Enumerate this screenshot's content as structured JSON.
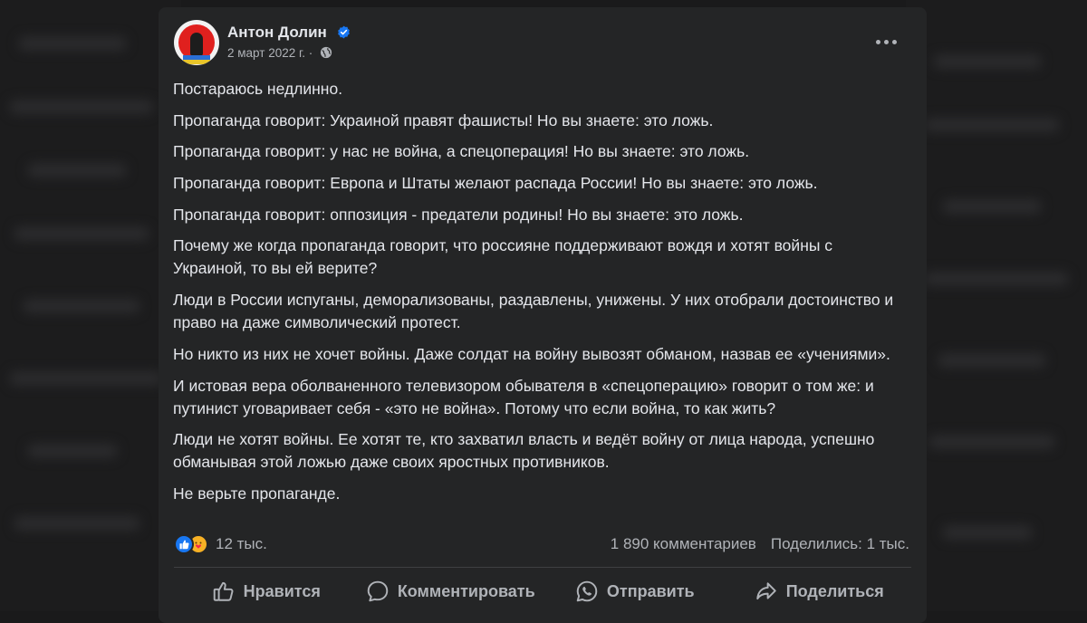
{
  "post": {
    "author": "Антон Долин",
    "date": "2 март 2022 г.",
    "separator": "·",
    "paragraphs": [
      "Постараюсь недлинно.",
      "Пропаганда говорит: Украиной правят фашисты! Но вы знаете: это ложь.",
      "Пропаганда говорит: у нас не война, а спецоперация! Но вы знаете: это ложь.",
      "Пропаганда говорит: Европа и Штаты желают распада России! Но вы знаете: это ложь.",
      "Пропаганда говорит: оппозиция - предатели родины! Но вы знаете: это ложь.",
      "Почему же когда пропаганда говорит, что россияне поддерживают вождя и хотят войны с Украиной, то вы ей верите?",
      "Люди в России испуганы, деморализованы, раздавлены, унижены. У них отобрали достоинство и право на даже символический протест.",
      "Но никто из них не хочет войны. Даже солдат на войну вывозят обманом, назвав ее «учениями».",
      "И истовая вера оболваненного телевизором обывателя в «спецоперацию» говорит о том же: и путинист уговаривает себя - «это не война». Потому что если война, то как жить?",
      "Люди не хотят войны. Ее хотят те, кто захватил власть и ведёт войну от лица народа, успешно обманывая этой ложью даже своих яростных противников.",
      "Не верьте пропаганде."
    ]
  },
  "stats": {
    "reactions_count": "12 тыс.",
    "comments": "1 890 комментариев",
    "shares": "Поделились: 1 тыс."
  },
  "actions": {
    "like": "Нравится",
    "comment": "Комментировать",
    "send": "Отправить",
    "share": "Поделиться"
  },
  "icons": {
    "verified": "verified-badge-icon",
    "audience": "globe-icon",
    "more": "more-options-icon",
    "like": "thumbs-up-icon",
    "comment": "comment-bubble-icon",
    "send": "whatsapp-icon",
    "share": "share-arrow-icon"
  },
  "colors": {
    "card_bg": "#242526",
    "text_primary": "#e4e6eb",
    "text_secondary": "#b0b3b8",
    "accent_blue": "#1877f2",
    "reaction_care": "#f7b125"
  }
}
